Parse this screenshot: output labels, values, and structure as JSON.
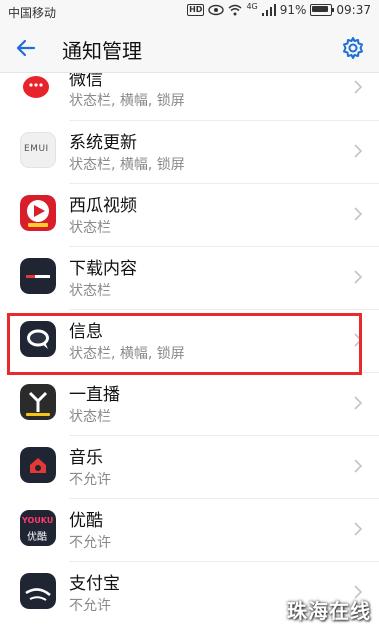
{
  "status_bar": {
    "carrier": "中国移动",
    "hd": "HD",
    "signal": "4G",
    "battery": "91%",
    "time": "09:37"
  },
  "header": {
    "title": "通知管理"
  },
  "apps": [
    {
      "name": "微信",
      "status": "状态栏, 横幅, 锁屏",
      "icon": "wechat-icon"
    },
    {
      "name": "系统更新",
      "status": "状态栏, 横幅, 锁屏",
      "icon": "emui-update-icon",
      "icon_text": "EMUI"
    },
    {
      "name": "西瓜视频",
      "status": "状态栏",
      "icon": "xigua-video-icon"
    },
    {
      "name": "下载内容",
      "status": "状态栏",
      "icon": "download-icon"
    },
    {
      "name": "信息",
      "status": "状态栏, 横幅, 锁屏",
      "icon": "messages-icon"
    },
    {
      "name": "一直播",
      "status": "状态栏",
      "icon": "yizhibo-icon"
    },
    {
      "name": "音乐",
      "status": "不允许",
      "icon": "music-icon"
    },
    {
      "name": "优酷",
      "status": "不允许",
      "icon": "youku-icon",
      "icon_text": "YOUKU",
      "icon_text_cn": "优酷"
    },
    {
      "name": "支付宝",
      "status": "不允许",
      "icon": "alipay-icon"
    }
  ],
  "highlighted_item": "信息",
  "watermark": "珠海在线",
  "colors": {
    "accent": "#1e6fd9",
    "highlight": "#e52b2b",
    "secondary_text": "#8a8a8a"
  }
}
